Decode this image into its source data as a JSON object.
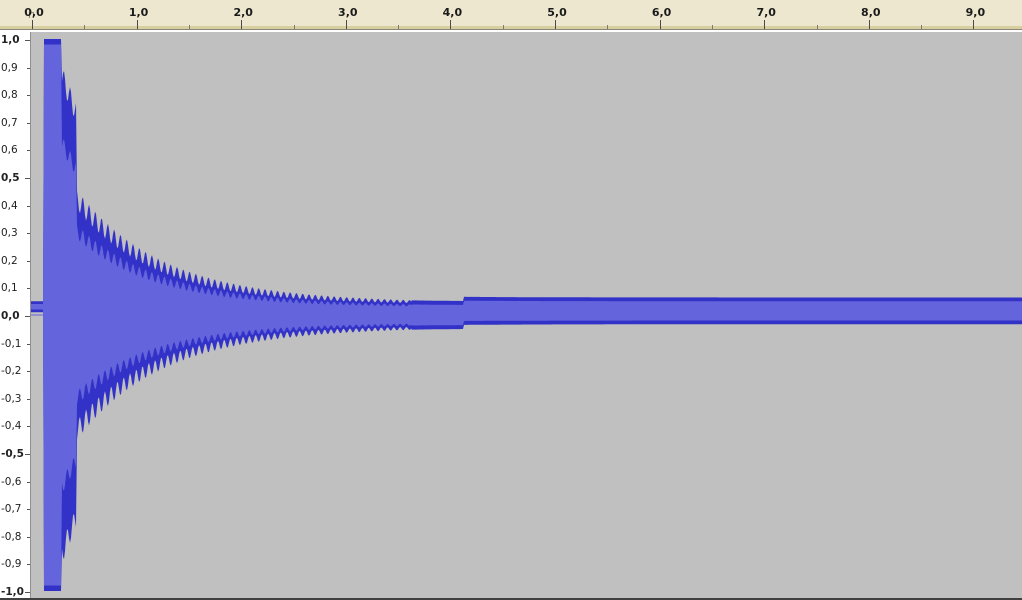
{
  "timeline": {
    "tick_labels": [
      "0,0",
      "1,0",
      "2,0",
      "3,0",
      "4,0",
      "5,0",
      "6,0",
      "7,0",
      "8,0",
      "9,0"
    ],
    "range_seconds": [
      0,
      9.45
    ]
  },
  "amplitude_scale": {
    "labels": [
      "1,0",
      "0,9",
      "0,8",
      "0,7",
      "0,6",
      "0,5",
      "0,4",
      "0,3",
      "0,2",
      "0,1",
      "0,0",
      "-0,1",
      "-0,2",
      "-0,3",
      "-0,4",
      "-0,5",
      "-0,6",
      "-0,7",
      "-0,8",
      "-0,9",
      "-1,0"
    ],
    "range": [
      -1.0,
      1.0
    ]
  },
  "waveform": {
    "onset_seconds": 0.13,
    "peak_amplitude": 1.0,
    "end_amplitude": 0.07
  },
  "colors": {
    "ruler_bg": "#ede7cf",
    "track_bg": "#c0c0c0",
    "wave_fill": "#6464dc",
    "wave_edge": "#3232c8"
  }
}
